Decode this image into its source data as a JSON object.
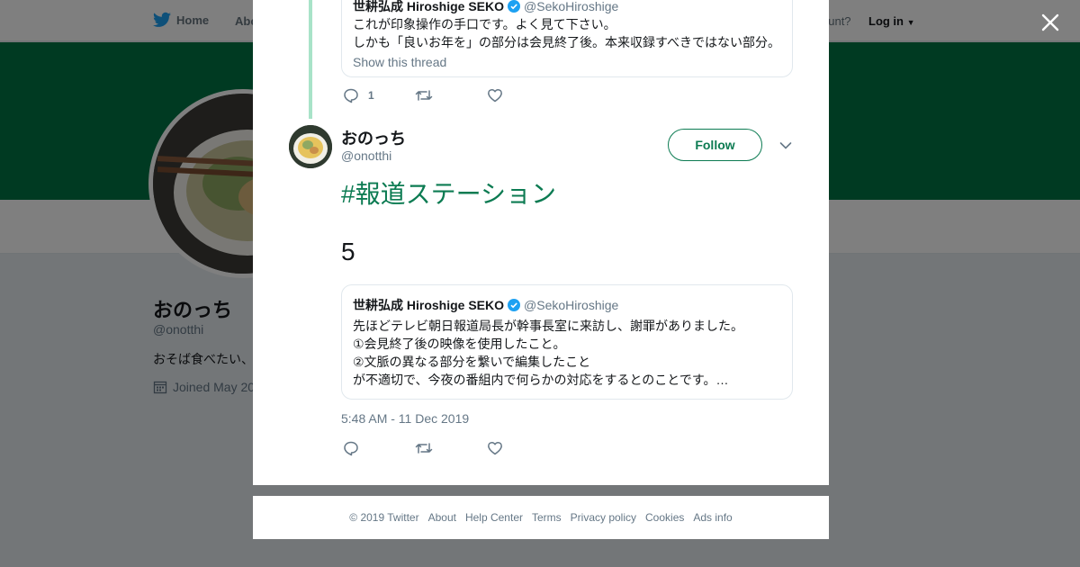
{
  "background": {
    "nav": {
      "home": "Home",
      "about": "Abo",
      "account_prompt": "ccount?",
      "login": "Log in"
    },
    "profile": {
      "name": "おのっち",
      "handle": "@onotthi",
      "bio": "おそば食べたい、",
      "joined": "Joined May 20"
    }
  },
  "colors": {
    "accent": "#0c7b52",
    "banner": "#007445",
    "thread_line": "#a8e3c8"
  },
  "modal": {
    "parent_tweet": {
      "quote": {
        "name": "世耕弘成 Hiroshige SEKO",
        "handle": "@SekoHiroshige",
        "lines": [
          "これが印象操作の手口です。よく見て下さい。",
          "しかも「良いお年を」の部分は会見終了後。本来収録すべきではない部分。"
        ],
        "show_thread": "Show this thread"
      },
      "reply_count": "1"
    },
    "tweet": {
      "name": "おのっち",
      "handle": "@onotthi",
      "follow_label": "Follow",
      "hashtag": "#報道ステーション",
      "body": "5",
      "quote": {
        "name": "世耕弘成 Hiroshige SEKO",
        "handle": "@SekoHiroshige",
        "lines": [
          "先ほどテレビ朝日報道局長が幹事長室に来訪し、謝罪がありました。",
          "①会見終了後の映像を使用したこと。",
          "②文脈の異なる部分を繋いで編集したこと",
          "が不適切で、今夜の番組内で何らかの対応をするとのことです。…"
        ]
      },
      "timestamp": "5:48 AM - 11 Dec 2019"
    }
  },
  "footer": {
    "copyright": "© 2019 Twitter",
    "links": [
      "About",
      "Help Center",
      "Terms",
      "Privacy policy",
      "Cookies",
      "Ads info"
    ]
  }
}
